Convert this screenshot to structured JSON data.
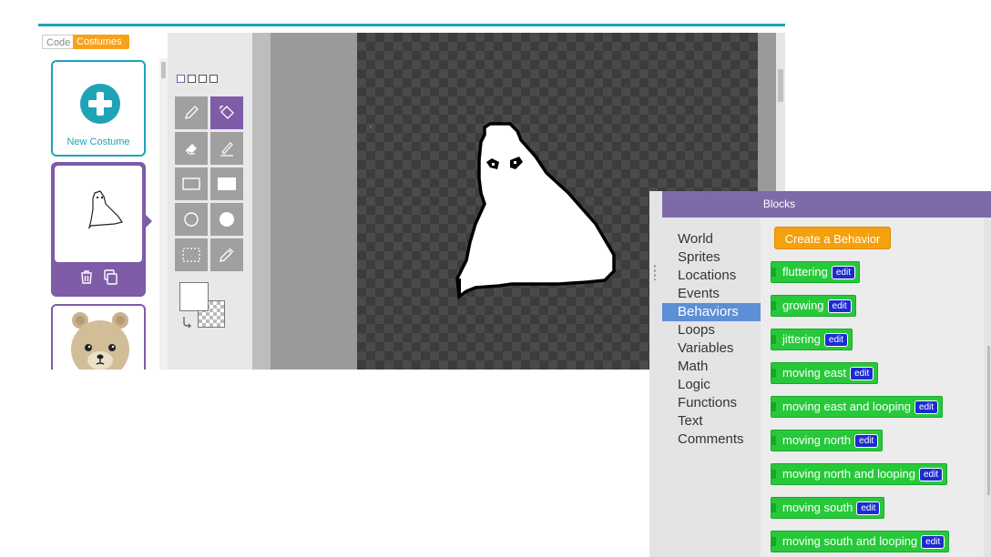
{
  "tabs": {
    "code": "Code",
    "costumes": "Costumes"
  },
  "costumes": {
    "new_costume_label": "New Costume"
  },
  "toolbox": {
    "title": "Blocks",
    "categories": [
      "World",
      "Sprites",
      "Locations",
      "Events",
      "Behaviors",
      "Loops",
      "Variables",
      "Math",
      "Logic",
      "Functions",
      "Text",
      "Comments"
    ],
    "selected_category": "Behaviors",
    "create_button": "Create a Behavior",
    "edit_label": "edit",
    "blocks": [
      "fluttering",
      "growing",
      "jittering",
      "moving east",
      "moving east and looping",
      "moving north",
      "moving north and looping",
      "moving south",
      "moving south and looping"
    ]
  },
  "colors": {
    "accent_teal": "#1fa3b7",
    "costumes_tab": "#f7a21a",
    "selected_purple": "#7e5ca8",
    "block_green": "#27c93a",
    "edit_blue": "#1d2bd1",
    "create_orange": "#f5a00f",
    "category_selected": "#5d8ed6"
  }
}
